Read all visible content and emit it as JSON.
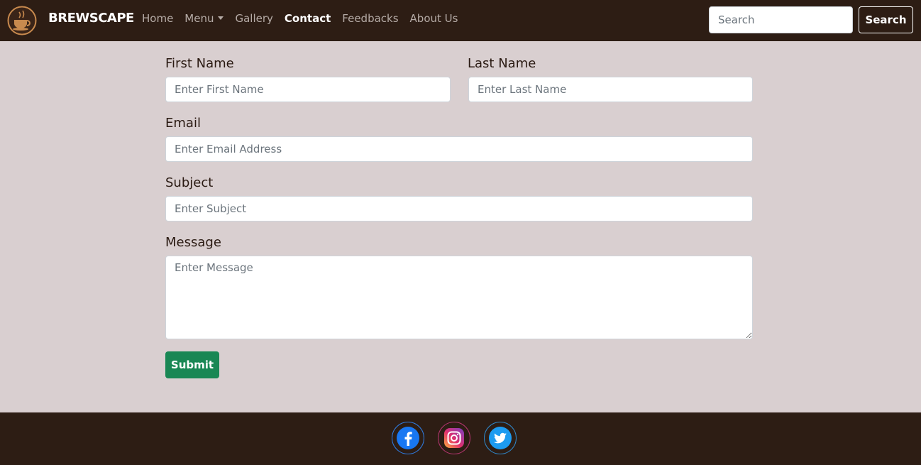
{
  "navbar": {
    "brand": "BREWSCAPE",
    "links": {
      "home": "Home",
      "menu": "Menu",
      "gallery": "Gallery",
      "contact": "Contact",
      "feedbacks": "Feedbacks",
      "about": "About Us"
    },
    "search_placeholder": "Search",
    "search_button": "Search"
  },
  "form": {
    "first_name_label": "First Name",
    "first_name_placeholder": "Enter First Name",
    "last_name_label": "Last Name",
    "last_name_placeholder": "Enter Last Name",
    "email_label": "Email",
    "email_placeholder": "Enter Email Address",
    "subject_label": "Subject",
    "subject_placeholder": "Enter Subject",
    "message_label": "Message",
    "message_placeholder": "Enter Message",
    "submit_label": "Submit"
  },
  "footer": {
    "icons": [
      "facebook-icon",
      "instagram-icon",
      "twitter-icon"
    ]
  },
  "colors": {
    "nav_bg": "#2d1d14",
    "page_bg": "#d9cfd0",
    "submit_green": "#198754"
  }
}
